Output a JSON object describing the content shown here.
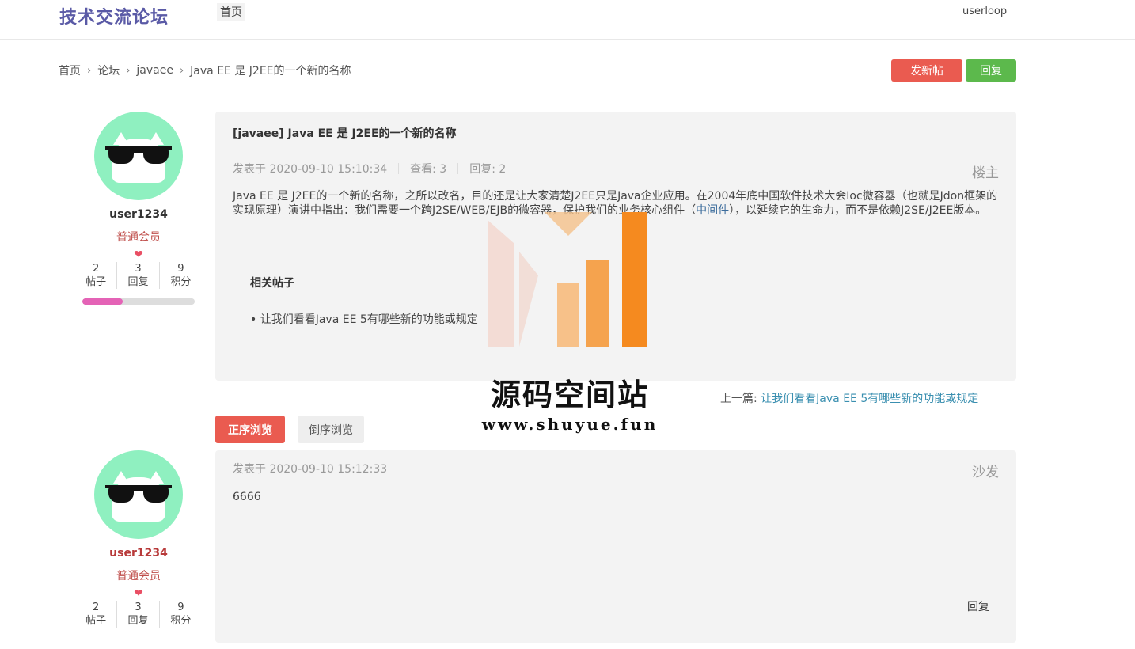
{
  "header": {
    "logo": "技术交流论坛",
    "nav_home": "首页",
    "username": "userloop"
  },
  "breadcrumb": {
    "items": [
      "首页",
      "论坛",
      "javaee",
      "Java EE 是 J2EE的一个新的名称"
    ],
    "separator": "›"
  },
  "actions": {
    "new_post": "发新帖",
    "reply": "回复"
  },
  "thread": {
    "title": "[javaee] Java EE 是 J2EE的一个新的名称",
    "posted_label": "发表于 2020-09-10 15:10:34",
    "views": "查看: 3",
    "replies": "回复: 2",
    "floor": "楼主",
    "content_before_link": "Java EE 是 J2EE的一个新的名称，之所以改名，目的还是让大家清楚J2EE只是Java企业应用。在2004年底中国软件技术大会Ioc微容器（也就是Jdon框架的实现原理）演讲中指出：我们需要一个跨J2SE/WEB/EJB的微容器，保护我们的业务核心组件（",
    "content_link": "中间件",
    "content_after_link": "），以延续它的生命力，而不是依赖J2SE/J2EE版本。",
    "related_title": "相关帖子",
    "related_items": [
      "• 让我们看看Java EE 5有哪些新的功能或规定"
    ]
  },
  "authors": [
    {
      "name": "user1234",
      "level": "普通会员",
      "heart": "❤",
      "stats": [
        {
          "value": "2",
          "label": "帖子"
        },
        {
          "value": "3",
          "label": "回复"
        },
        {
          "value": "9",
          "label": "积分"
        }
      ],
      "progress": 0.36
    },
    {
      "name": "user1234",
      "level": "普通会员",
      "heart": "❤",
      "stats": [
        {
          "value": "2",
          "label": "帖子"
        },
        {
          "value": "3",
          "label": "回复"
        },
        {
          "value": "9",
          "label": "积分"
        }
      ]
    }
  ],
  "prev_thread": {
    "label": "上一篇:",
    "title": "让我们看看Java EE 5有哪些新的功能或规定"
  },
  "sort": {
    "asc": "正序浏览",
    "desc": "倒序浏览"
  },
  "reply_post": {
    "posted_label": "发表于 2020-09-10 15:12:33",
    "floor": "沙发",
    "content": "6666",
    "reply_link": "回复"
  },
  "watermark": {
    "name": "源码空间站",
    "url": "www.shuyue.fun"
  },
  "colors": {
    "logo": "#5a5aa6",
    "primary_red": "#ea5b50",
    "primary_green": "#5cb94c",
    "avatar_bg": "#8ff0c0",
    "link": "#3a6b9b"
  }
}
